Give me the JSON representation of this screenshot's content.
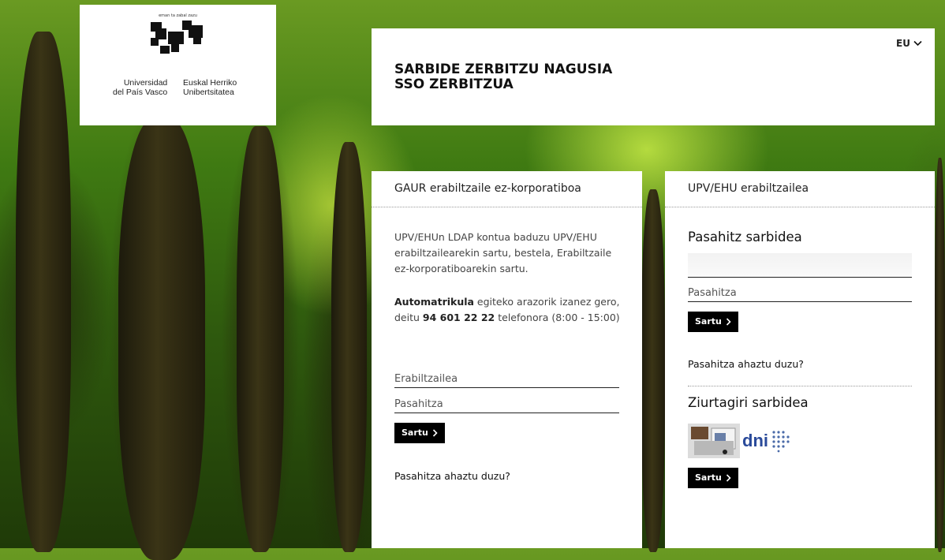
{
  "logo": {
    "tagline": "eman ta zabal zazu",
    "name_es_line1": "Universidad",
    "name_es_line2": "del País Vasco",
    "name_eu_line1": "Euskal Herriko",
    "name_eu_line2": "Unibertsitatea"
  },
  "header": {
    "language": "EU",
    "title_line1": "SARBIDE ZERBITZU NAGUSIA",
    "title_line2": "SSO ZERBITZUA"
  },
  "left_panel": {
    "heading": "GAUR erabiltzaile ez-korporatiboa",
    "info_text": "UPV/EHUn LDAP kontua baduzu UPV/EHU erabiltzailearekin sartu, bestela, Erabiltzaile ez-korporatiboarekin sartu.",
    "automatricula_bold": "Automatrikula",
    "automatricula_text": " egiteko arazorik izanez gero, deitu ",
    "phone": "94 601 22 22",
    "phone_suffix": " telefonora (8:00 - 15:00)",
    "username_placeholder": "Erabiltzailea",
    "password_placeholder": "Pasahitza",
    "submit_label": "Sartu",
    "forgot_link": "Pasahitza ahaztu duzu?"
  },
  "right_panel": {
    "heading": "UPV/EHU erabiltzailea",
    "password_section_title": "Pasahitz sarbidea",
    "username_value": "",
    "password_placeholder": "Pasahitza",
    "submit_label": "Sartu",
    "forgot_link": "Pasahitza ahaztu duzu?",
    "certificate_section_title": "Ziurtagiri sarbidea",
    "dni_label": "dni",
    "certificate_submit_label": "Sartu"
  },
  "icons": {
    "language_toggle": "chevron-down-icon",
    "submit": "chevron-right-icon"
  }
}
